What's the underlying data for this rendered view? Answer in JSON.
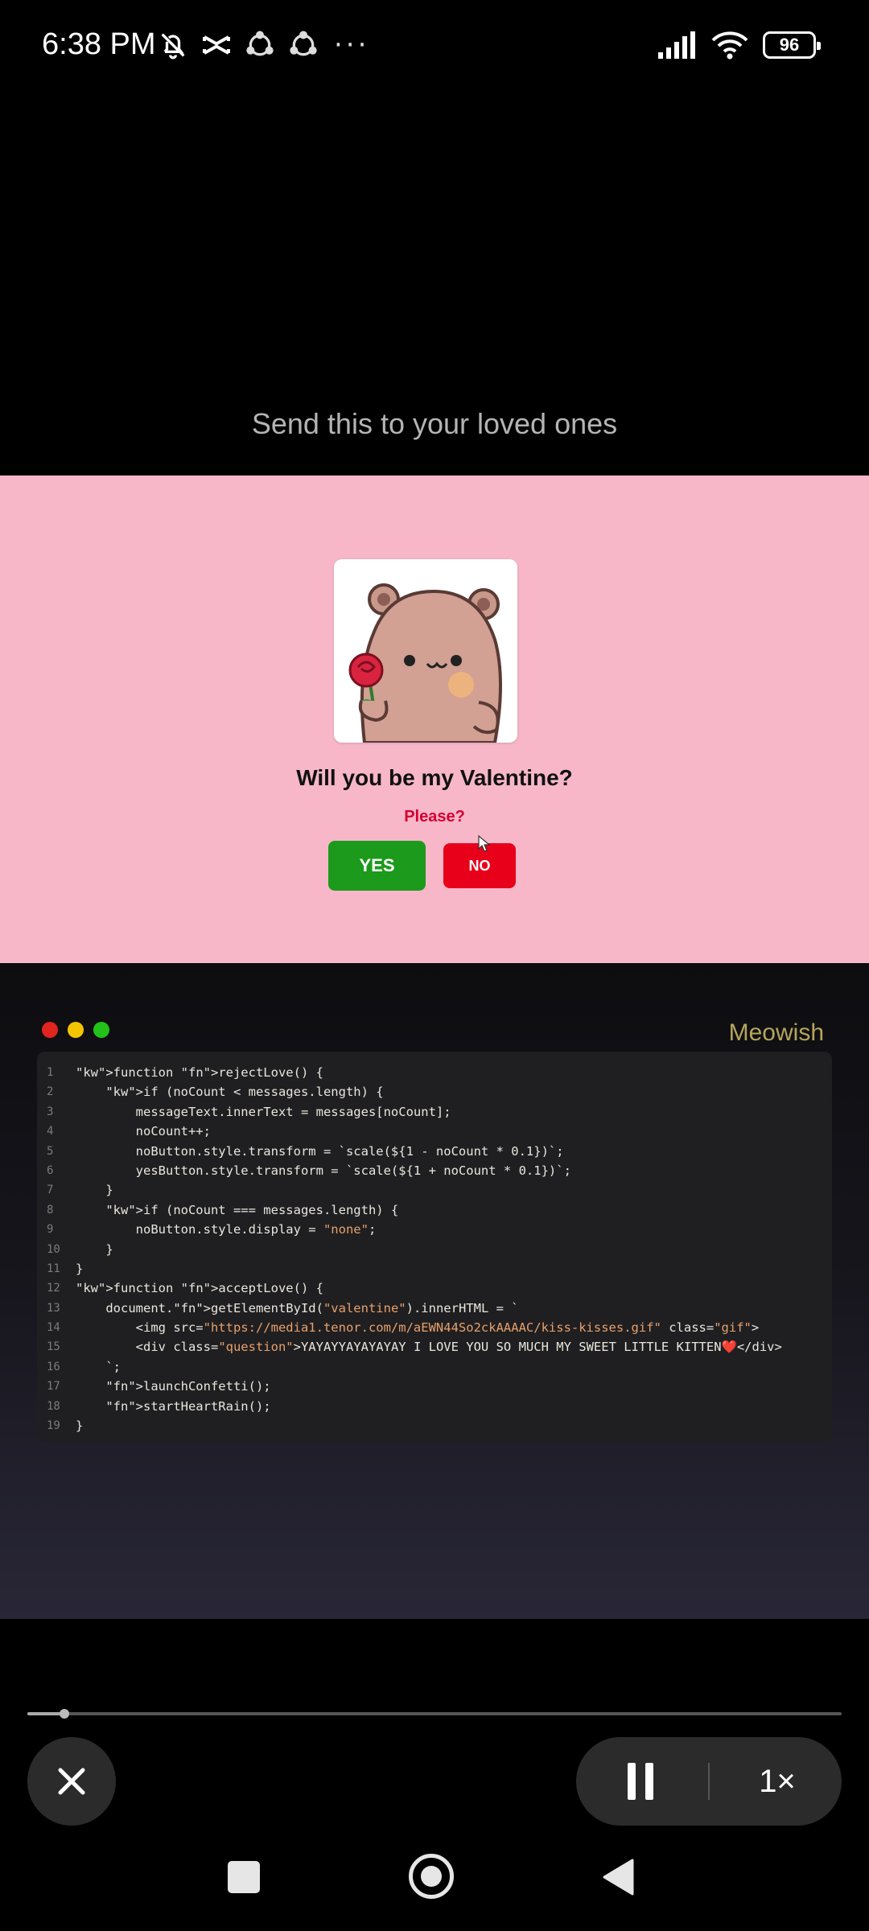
{
  "status_bar": {
    "time": "6:38 PM",
    "overflow": "···",
    "battery": "96",
    "icons": [
      "bell-off-icon",
      "capcut-icon",
      "share-icon",
      "share-icon",
      "signal-icon",
      "wifi-icon",
      "battery-icon"
    ]
  },
  "video": {
    "title": "Send this to your loved ones"
  },
  "demo": {
    "question": "Will you be my Valentine?",
    "please": "Please?",
    "yes_label": "YES",
    "no_label": "NO",
    "bg_color": "#f7b7c9",
    "yes_color": "#1c9a1c",
    "no_color": "#e8001b"
  },
  "code": {
    "brand": "Meowish",
    "lines": [
      {
        "n": "1",
        "text": "function rejectLove() {"
      },
      {
        "n": "2",
        "text": "    if (noCount < messages.length) {"
      },
      {
        "n": "3",
        "text": "        messageText.innerText = messages[noCount];"
      },
      {
        "n": "4",
        "text": "        noCount++;"
      },
      {
        "n": "5",
        "text": "        noButton.style.transform = `scale(${1 - noCount * 0.1})`;"
      },
      {
        "n": "6",
        "text": "        yesButton.style.transform = `scale(${1 + noCount * 0.1})`;"
      },
      {
        "n": "7",
        "text": "    }"
      },
      {
        "n": "8",
        "text": "    if (noCount === messages.length) {"
      },
      {
        "n": "9",
        "text": "        noButton.style.display = \"none\";"
      },
      {
        "n": "10",
        "text": "    }"
      },
      {
        "n": "11",
        "text": "}"
      },
      {
        "n": "12",
        "text": "function acceptLove() {"
      },
      {
        "n": "13",
        "text": "    document.getElementById(\"valentine\").innerHTML = `"
      },
      {
        "n": "14",
        "text": "        <img src=\"https://media1.tenor.com/m/aEWN44So2ckAAAAC/kiss-kisses.gif\" class=\"gif\">"
      },
      {
        "n": "15",
        "text": "        <div class=\"question\">YAYAYYAYAYAYAY I LOVE YOU SO MUCH MY SWEET LITTLE KITTEN❤️</div>"
      },
      {
        "n": "16",
        "text": "    `;"
      },
      {
        "n": "17",
        "text": "    launchConfetti();"
      },
      {
        "n": "18",
        "text": "    startHeartRain();"
      },
      {
        "n": "19",
        "text": "}"
      }
    ]
  },
  "player": {
    "progress": 0.045,
    "speed": "1×"
  }
}
